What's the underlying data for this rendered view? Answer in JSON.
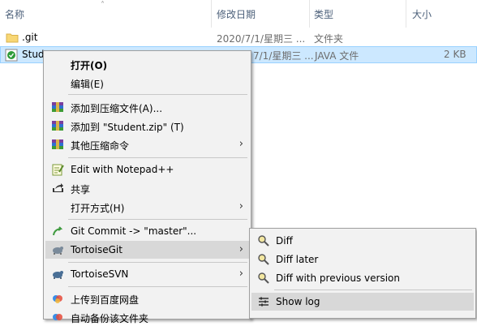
{
  "columns": {
    "name": "名称",
    "modified": "修改日期",
    "type": "类型",
    "size": "大小"
  },
  "files": [
    {
      "name": ".git",
      "modified": "2020/7/1/星期三 ...",
      "type": "文件夹",
      "size": "",
      "icon": "folder-icon"
    },
    {
      "name": "Stud",
      "modified": "7/1/星期三 ...",
      "type": "JAVA 文件",
      "size": "2 KB",
      "icon": "java-file-icon"
    }
  ],
  "context_menu": {
    "items": [
      {
        "label": "打开(O)",
        "bold": true,
        "icon": "",
        "arrow": false
      },
      {
        "label": "编辑(E)",
        "icon": "",
        "arrow": false
      },
      {
        "label": "添加到压缩文件(A)...",
        "icon": "winrar-icon",
        "arrow": false
      },
      {
        "label": "添加到 \"Student.zip\" (T)",
        "icon": "winrar-icon",
        "arrow": false
      },
      {
        "label": "其他压缩命令",
        "icon": "winrar-icon",
        "arrow": true
      },
      {
        "label": "Edit with Notepad++",
        "icon": "notepad-plus-plus-icon",
        "arrow": false
      },
      {
        "label": "共享",
        "icon": "share-icon",
        "arrow": false
      },
      {
        "label": "打开方式(H)",
        "icon": "",
        "arrow": true
      },
      {
        "label": "Git Commit -> \"master\"...",
        "icon": "git-commit-icon",
        "arrow": false
      },
      {
        "label": "TortoiseGit",
        "icon": "tortoisegit-icon",
        "arrow": true,
        "highlighted": true
      },
      {
        "label": "TortoiseSVN",
        "icon": "tortoisesvn-icon",
        "arrow": true
      },
      {
        "label": "上传到百度网盘",
        "icon": "baidu-netdisk-icon",
        "arrow": false
      },
      {
        "label": "自动备份该文件夹",
        "icon": "baidu-backup-icon",
        "arrow": false
      }
    ]
  },
  "submenu": {
    "items": [
      {
        "label": "Diff",
        "icon": "diff-magnifier-icon"
      },
      {
        "label": "Diff later",
        "icon": "diff-later-magnifier-icon"
      },
      {
        "label": "Diff with previous version",
        "icon": "diff-previous-magnifier-icon"
      },
      {
        "label": "Show log",
        "icon": "show-log-icon",
        "highlighted": true
      }
    ]
  },
  "colors": {
    "selection": "#cce8ff",
    "menu_bg": "#f2f2f2",
    "menu_highlight": "#d8d8d8"
  }
}
